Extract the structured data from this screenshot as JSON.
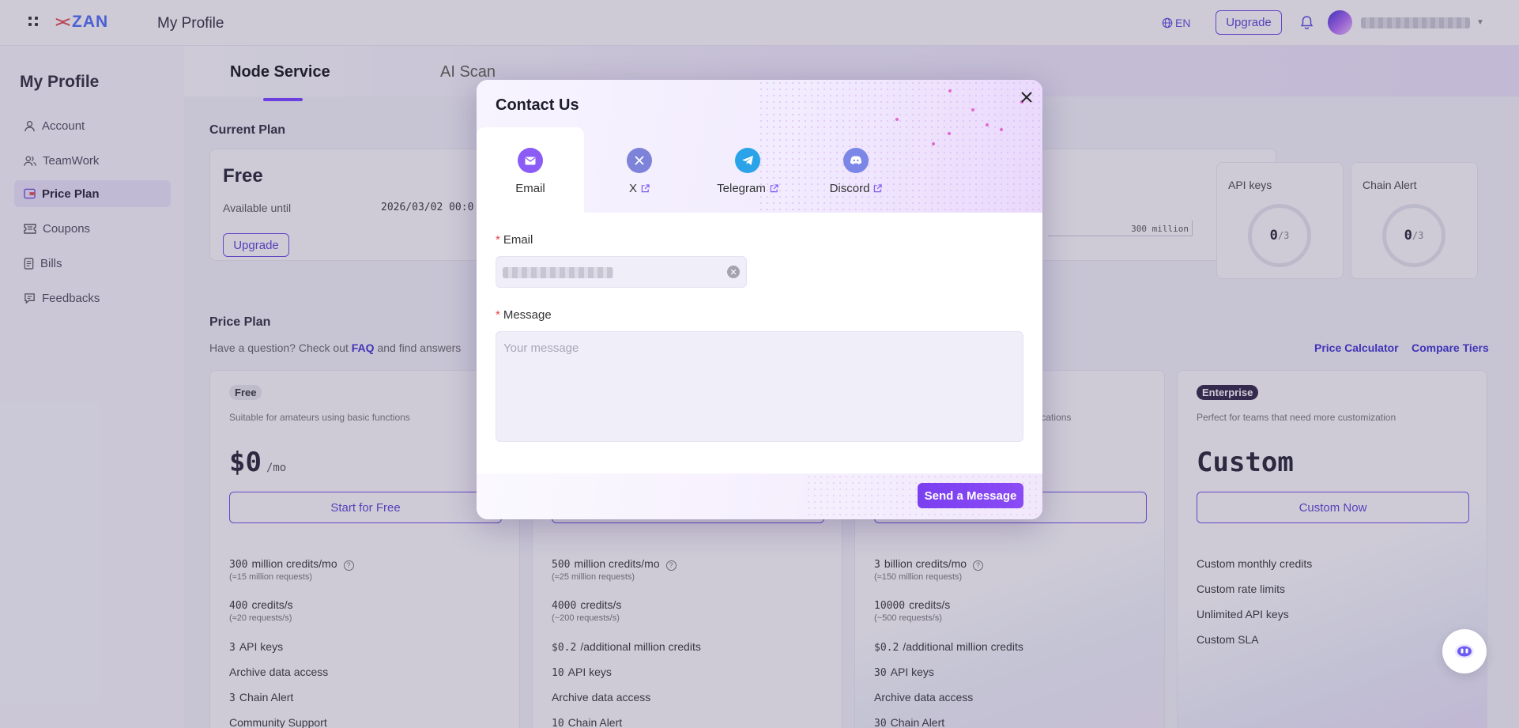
{
  "app": {
    "logo_text": "ZAN",
    "title": "My Profile"
  },
  "topbar": {
    "lang": "EN",
    "upgrade_label": "Upgrade"
  },
  "sidebar": {
    "title": "My Profile",
    "items": [
      {
        "label": "Account",
        "icon": "user-icon"
      },
      {
        "label": "TeamWork",
        "icon": "team-icon"
      },
      {
        "label": "Price Plan",
        "icon": "card-icon",
        "active": true
      },
      {
        "label": "Coupons",
        "icon": "ticket-icon"
      },
      {
        "label": "Bills",
        "icon": "bill-icon"
      },
      {
        "label": "Feedbacks",
        "icon": "chat-icon"
      }
    ]
  },
  "tabs": [
    {
      "label": "Node Service",
      "active": true
    },
    {
      "label": "AI Scan"
    }
  ],
  "current_plan": {
    "section_title": "Current Plan",
    "name": "Free",
    "available_label": "Available until",
    "available_value": "2026/03/02 00:0",
    "upgrade_label": "Upgrade",
    "usage_limit": "300 million",
    "api_keys": {
      "label": "API keys",
      "used": "0",
      "total": "/3"
    },
    "chain_alert": {
      "label": "Chain Alert",
      "used": "0",
      "total": "/3"
    }
  },
  "price_plan": {
    "section_title": "Price Plan",
    "faq_prefix": "Have a question? Check out ",
    "faq_link": "FAQ",
    "faq_suffix": " and find answers",
    "calculator_link": "Price Calculator",
    "compare_link": "Compare Tiers",
    "cards": [
      {
        "badge": "Free",
        "desc": "Suitable for amateurs using basic functions",
        "price": "$0",
        "period": "/mo",
        "button": "Start for Free",
        "features": [
          {
            "num": "300",
            "text": "million credits/mo",
            "sub": "(≈15 million requests)"
          },
          {
            "num": "400",
            "text": "credits/s",
            "sub": "(≈20 requests/s)"
          },
          {
            "num": "3",
            "text": "API keys"
          },
          {
            "num": "",
            "text": "Archive data access"
          },
          {
            "num": "3",
            "text": "Chain Alert"
          },
          {
            "num": "",
            "text": "Community Support"
          }
        ]
      },
      {
        "features": [
          {
            "num": "500",
            "text": "million credits/mo",
            "sub": "(≈25 million requests)"
          },
          {
            "num": "4000",
            "text": "credits/s",
            "sub": "(~200 requests/s)"
          },
          {
            "num": "$0.2",
            "text": "/additional million credits"
          },
          {
            "num": "10",
            "text": "API keys"
          },
          {
            "num": "",
            "text": "Archive data access"
          },
          {
            "num": "10",
            "text": "Chain Alert"
          }
        ]
      },
      {
        "desc_tail": "applications",
        "features": [
          {
            "num": "3",
            "text": "billion credits/mo",
            "sub": "(≈150 million requests)"
          },
          {
            "num": "10000",
            "text": "credits/s",
            "sub": "(~500 requests/s)"
          },
          {
            "num": "$0.2",
            "text": "/additional million credits"
          },
          {
            "num": "30",
            "text": "API keys"
          },
          {
            "num": "",
            "text": "Archive data access"
          },
          {
            "num": "30",
            "text": "Chain Alert"
          }
        ]
      },
      {
        "badge": "Enterprise",
        "desc": "Perfect for teams that need more customization",
        "price": "Custom",
        "button": "Custom Now",
        "features": [
          {
            "text": "Custom monthly credits"
          },
          {
            "text": "Custom rate limits"
          },
          {
            "text": "Unlimited API keys"
          },
          {
            "text": "Custom SLA"
          }
        ]
      }
    ]
  },
  "modal": {
    "title": "Contact Us",
    "channels": [
      {
        "label": "Email",
        "icon": "mail-icon",
        "color": "#8b5cf6",
        "active": true,
        "external": false
      },
      {
        "label": "X",
        "icon": "x-icon",
        "color": "#7c83d9",
        "external": true
      },
      {
        "label": "Telegram",
        "icon": "telegram-icon",
        "color": "#2aa3e8",
        "external": true
      },
      {
        "label": "Discord",
        "icon": "discord-icon",
        "color": "#7b86e6",
        "external": true
      }
    ],
    "email_label": "Email",
    "message_label": "Message",
    "message_placeholder": "Your message",
    "send_label": "Send a Message"
  }
}
